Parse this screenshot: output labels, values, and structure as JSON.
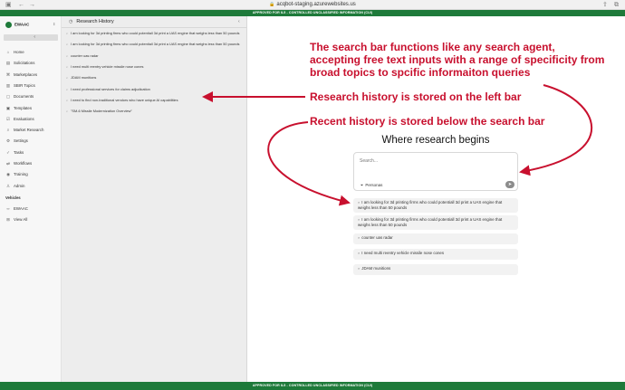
{
  "browser": {
    "url": "acqbot-staging.azurewebsites.us",
    "icons": [
      "sidebar-icon",
      "back-icon",
      "forward-icon",
      "lock-icon",
      "share-icon",
      "tabs-icon"
    ]
  },
  "banners": {
    "top": "APPROVED FOR IL5 - CONTROLLED UNCLASSIFIED INFORMATION (CUI)",
    "bottom": "APPROVED FOR IL5 - CONTROLLED UNCLASSIFIED INFORMATION (CUI)"
  },
  "sidebar": {
    "org": "EWAAC",
    "collapse_glyph": "‹",
    "items": [
      {
        "label": "Home",
        "icon": "home-icon",
        "glyph": "⌂"
      },
      {
        "label": "Solicitations",
        "icon": "document-icon",
        "glyph": "▤"
      },
      {
        "label": "Marketplaces",
        "icon": "store-icon",
        "glyph": "⌘"
      },
      {
        "label": "SBIR Topics",
        "icon": "book-icon",
        "glyph": "▥"
      },
      {
        "label": "Documents",
        "icon": "file-icon",
        "glyph": "▢"
      },
      {
        "label": "Templates",
        "icon": "template-icon",
        "glyph": "▣"
      },
      {
        "label": "Evaluations",
        "icon": "checklist-icon",
        "glyph": "☑"
      },
      {
        "label": "Market Research",
        "icon": "search-icon",
        "glyph": "⌕"
      },
      {
        "label": "Settings",
        "icon": "gear-icon",
        "glyph": "⚙"
      },
      {
        "label": "Tasks",
        "icon": "check-icon",
        "glyph": "✓"
      },
      {
        "label": "Workflows",
        "icon": "flow-icon",
        "glyph": "⇄"
      },
      {
        "label": "Training",
        "icon": "training-icon",
        "glyph": "◉"
      },
      {
        "label": "Admin",
        "icon": "admin-icon",
        "glyph": "♙"
      }
    ],
    "vehicles_label": "Vehicles",
    "vehicle_items": [
      {
        "label": "EWAAC",
        "icon": "link-icon",
        "glyph": "∞"
      },
      {
        "label": "View All",
        "icon": "grid-icon",
        "glyph": "⊞"
      }
    ]
  },
  "history": {
    "title": "Research History",
    "close_glyph": "‹",
    "items": [
      "I am looking for 3d printing firms who could potentiall 3d print a UAS engine that weighs less than 50 pounds",
      "I am looking for 3d printing firms who could potentiall 3d print a UAS engine that weighs less than 50 pounds",
      "counter uas radar",
      "I need multi reentry vehicle missile nose cones",
      "JDAM munitions",
      "I need professional services for claims adjudication",
      "I need to find non-traditional vendors who have unique AI capabilities",
      "\"SM-6 Missile Modernization Overview\""
    ]
  },
  "annotations": {
    "search_note": "The search bar functions like any search agent, accepting free text inputs with a range of specificity from broad topics to spcific informaiton queries",
    "history_note": "Research history is stored on the left bar",
    "recent_note": "Recent history is stored below the search bar"
  },
  "main": {
    "heading": "Where research begins",
    "search_placeholder": "Search...",
    "personas_label": "Personas",
    "send_glyph": "➤",
    "recent": [
      "I am looking for 3d printing firms who could potentiall 3d print a UAS engine that weighs less than 50 pounds",
      "I am looking for 3d printing firms who could potentiall 3d print a UAS engine that weighs less than 50 pounds",
      "counter uas radar",
      "I need multi reentry vehicle missile nose cones",
      "JDAM munitions"
    ]
  },
  "colors": {
    "banner": "#1e7a3a",
    "annotation": "#c8102e"
  }
}
